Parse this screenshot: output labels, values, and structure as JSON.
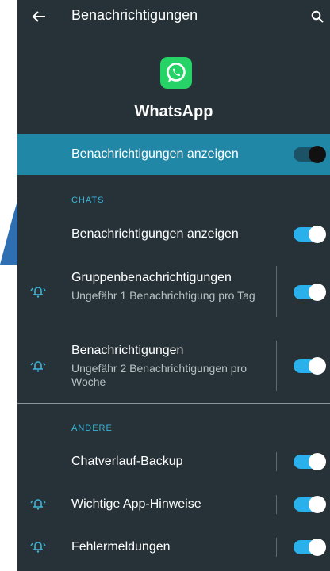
{
  "header": {
    "title": "Benachrichtigungen",
    "back_icon": "arrow-left-icon",
    "search_icon": "search-icon"
  },
  "app": {
    "name": "WhatsApp",
    "icon": "whatsapp-icon",
    "brand_color": "#25d366"
  },
  "master": {
    "label": "Benachrichtigungen anzeigen",
    "enabled": true
  },
  "sections": {
    "chats": "CHATS",
    "other": "ANDERE"
  },
  "chats": {
    "show": {
      "label": "Benachrichtigungen anzeigen",
      "enabled": true
    },
    "groups": {
      "label": "Gruppenbenachrichtigungen",
      "sub": "Ungefähr 1 Benachrichtigung pro Tag",
      "enabled": true
    },
    "messages": {
      "label": "Benachrichtigungen",
      "sub": "Ungefähr 2 Benachrichtigungen pro Woche",
      "enabled": true
    }
  },
  "other": {
    "backup": {
      "label": "Chatverlauf-Backup",
      "enabled": true
    },
    "important": {
      "label": "Wichtige App-Hinweise",
      "enabled": true
    },
    "errors": {
      "label": "Fehlermeldungen",
      "enabled": true
    }
  },
  "colors": {
    "background": "#263238",
    "highlight": "#2187a6",
    "accent": "#39b6da",
    "toggle_on": "#2ab0ea"
  }
}
